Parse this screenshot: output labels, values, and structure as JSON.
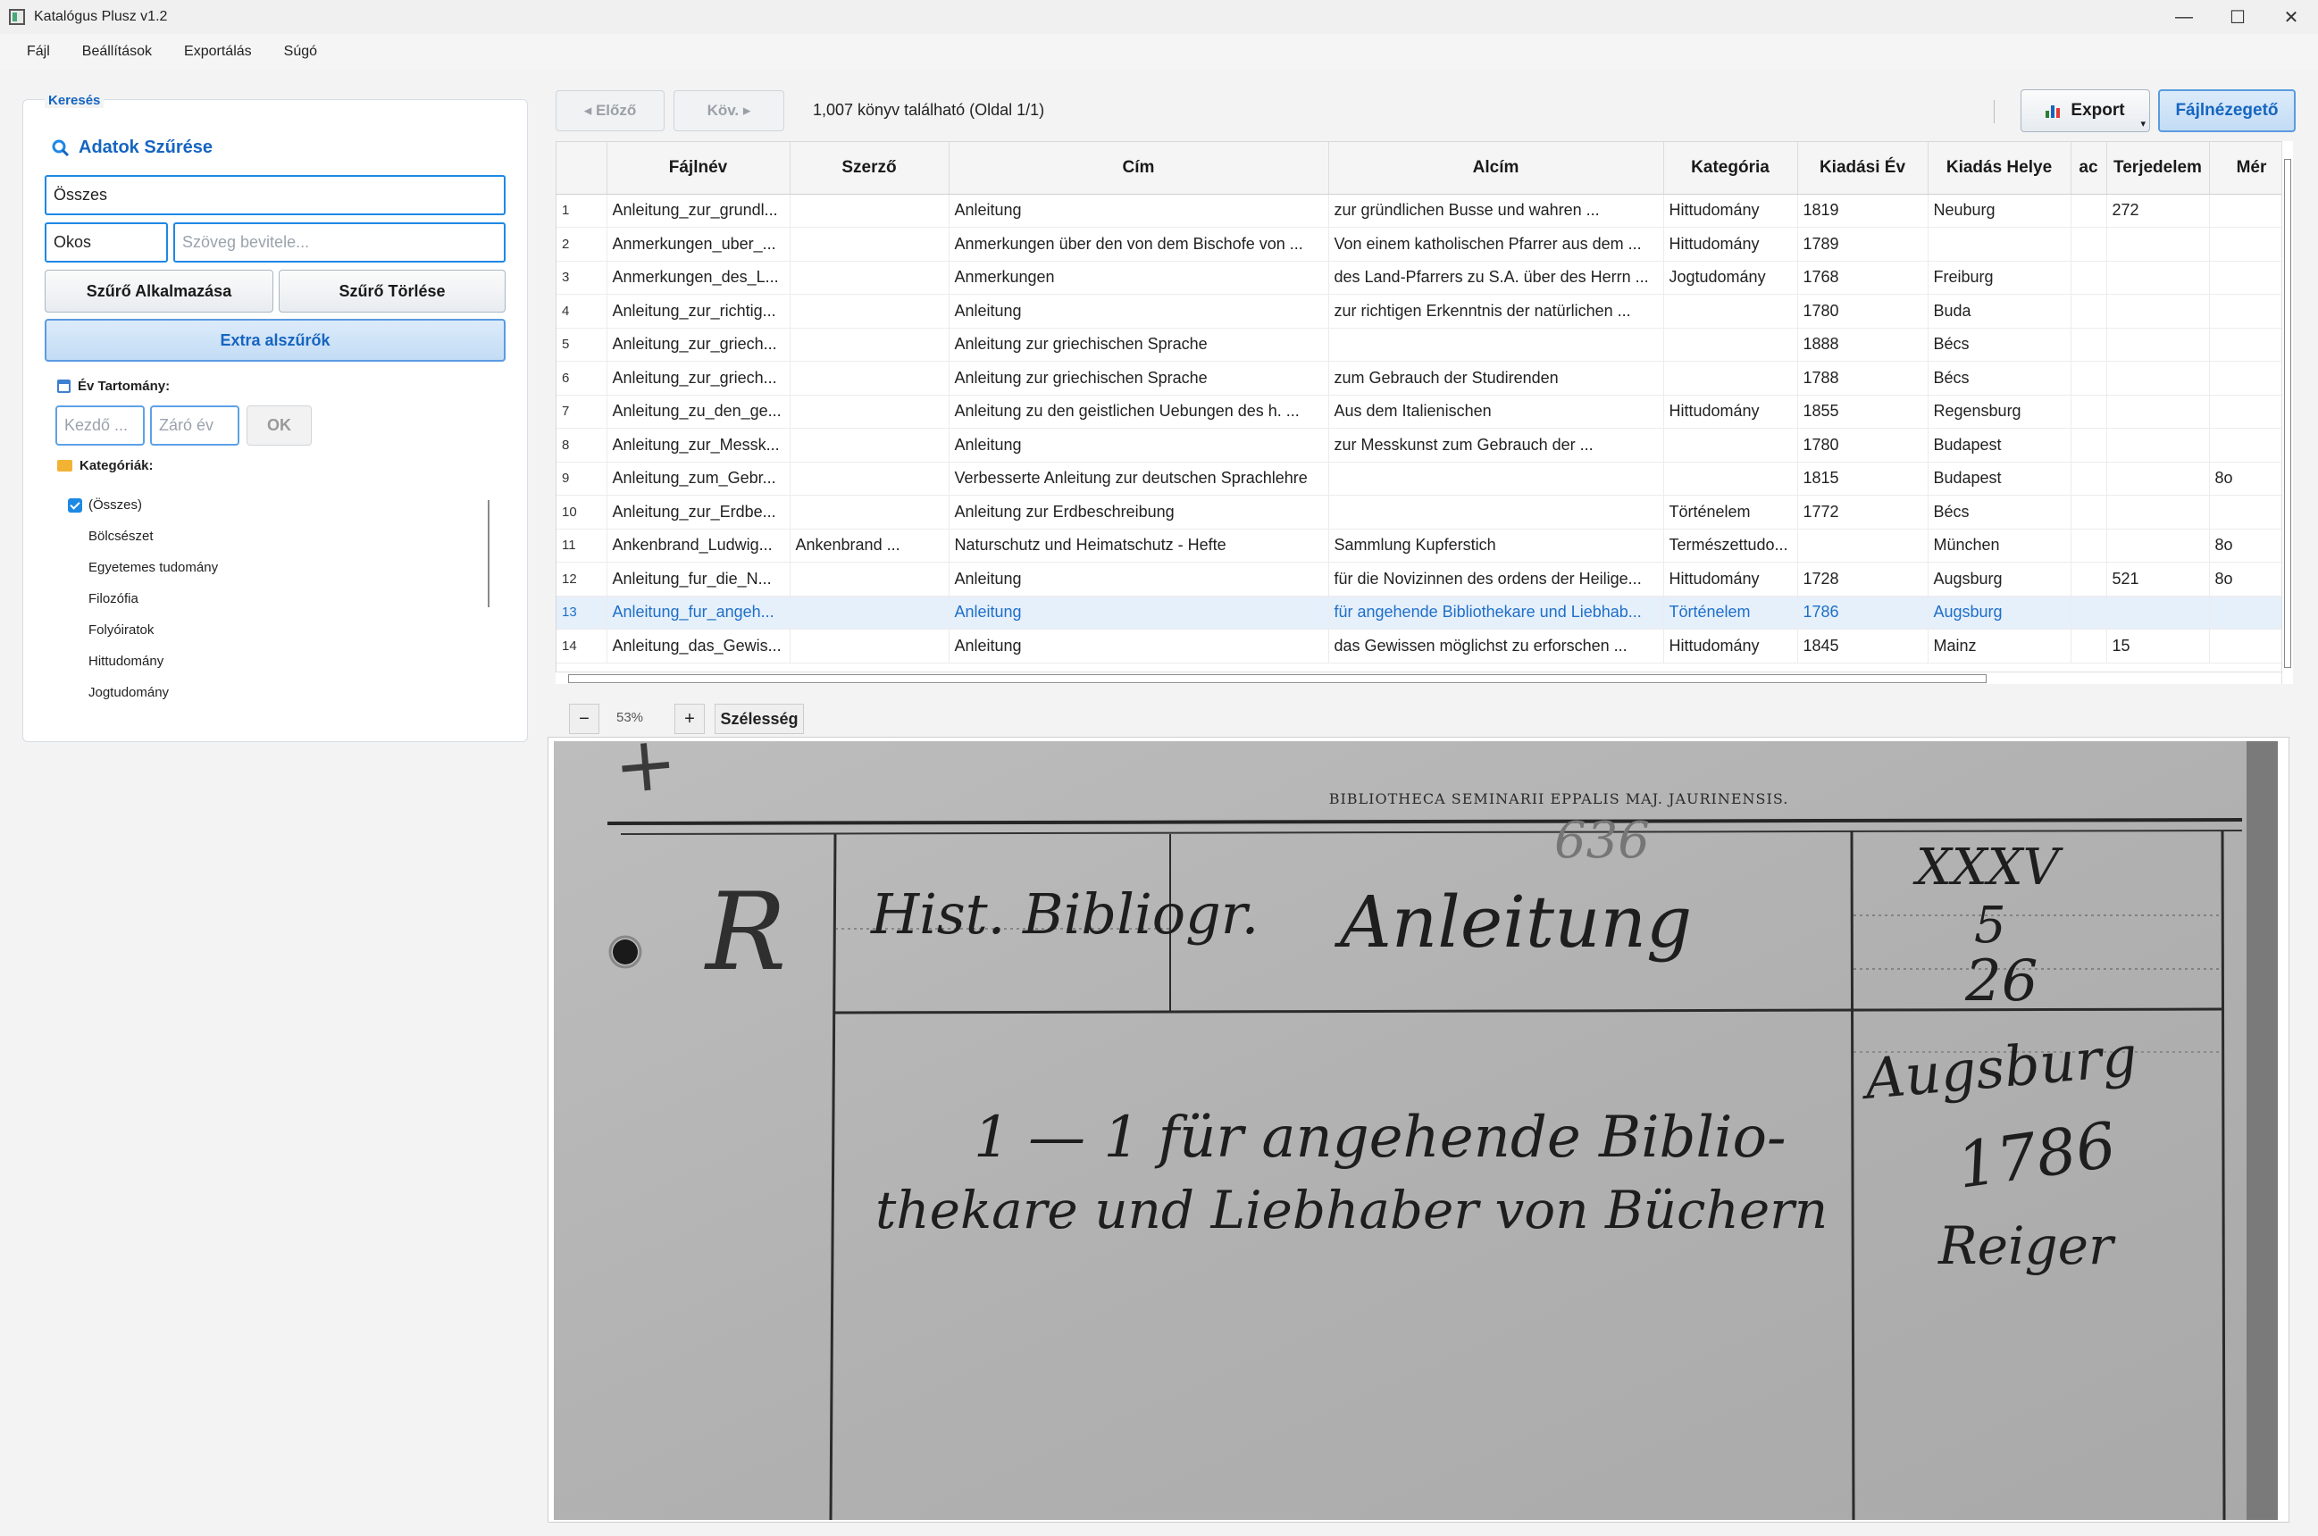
{
  "window": {
    "title": "Katalógus Plusz v1.2",
    "minimize": "—",
    "maximize": "☐",
    "close": "✕"
  },
  "menu": [
    "Fájl",
    "Beállítások",
    "Exportálás",
    "Súgó"
  ],
  "search_panel": {
    "group_title": "Keresés",
    "heading": "Adatok Szűrése",
    "field_select": "Összes",
    "mode_select": "Okos",
    "text_placeholder": "Szöveg bevitele...",
    "apply_button": "Szűrő Alkalmazása",
    "clear_button": "Szűrő Törlése",
    "extra_button": "Extra alszűrők",
    "year_label": "Év Tartomány:",
    "year_start_placeholder": "Kezdő ...",
    "year_end_placeholder": "Záró év",
    "ok_button": "OK",
    "categories_label": "Kategóriák:",
    "categories": [
      "(Összes)",
      "Bölcsészet",
      "Egyetemes tudomány",
      "Filozófia",
      "Folyóiratok",
      "Hittudomány",
      "Jogtudomány"
    ]
  },
  "toolbar": {
    "prev_button": "◂ Előző",
    "next_button": "Köv. ▸",
    "result_text": "1,007 könyv található (Oldal 1/1)",
    "export_button": "Export",
    "viewer_button": "Fájlnézegető"
  },
  "table": {
    "columns": [
      "",
      "Fájlnév",
      "Szerző",
      "Cím",
      "Alcím",
      "Kategória",
      "Kiadási Év",
      "Kiadás Helye",
      "ac",
      "Terjedelem",
      "Mér"
    ],
    "rows": [
      [
        "1",
        "Anleitung_zur_grundl...",
        "",
        "Anleitung",
        "zur gründlichen Busse und wahren ...",
        "Hittudomány",
        "1819",
        "Neuburg",
        "",
        "272",
        ""
      ],
      [
        "2",
        "Anmerkungen_uber_...",
        "",
        "Anmerkungen über den von dem Bischofe von ...",
        "Von einem katholischen Pfarrer aus dem ...",
        "Hittudomány",
        "1789",
        "",
        "",
        "",
        ""
      ],
      [
        "3",
        "Anmerkungen_des_L...",
        "",
        "Anmerkungen",
        "des Land-Pfarrers zu S.A. über des Herrn ...",
        "Jogtudomány",
        "1768",
        "Freiburg",
        "",
        "",
        ""
      ],
      [
        "4",
        "Anleitung_zur_richtig...",
        "",
        "Anleitung",
        "zur richtigen Erkenntnis der natürlichen ...",
        "",
        "1780",
        "Buda",
        "",
        "",
        ""
      ],
      [
        "5",
        "Anleitung_zur_griech...",
        "",
        "Anleitung zur griechischen Sprache",
        "",
        "",
        "1888",
        "Bécs",
        "",
        "",
        ""
      ],
      [
        "6",
        "Anleitung_zur_griech...",
        "",
        "Anleitung zur griechischen Sprache",
        "zum Gebrauch der Studirenden",
        "",
        "1788",
        "Bécs",
        "",
        "",
        ""
      ],
      [
        "7",
        "Anleitung_zu_den_ge...",
        "",
        "Anleitung zu den geistlichen Uebungen des h. ...",
        "Aus dem Italienischen",
        "Hittudomány",
        "1855",
        "Regensburg",
        "",
        "",
        ""
      ],
      [
        "8",
        "Anleitung_zur_Messk...",
        "",
        "Anleitung",
        "zur Messkunst zum Gebrauch der ...",
        "",
        "1780",
        "Budapest",
        "",
        "",
        ""
      ],
      [
        "9",
        "Anleitung_zum_Gebr...",
        "",
        "Verbesserte Anleitung zur deutschen Sprachlehre",
        "",
        "",
        "1815",
        "Budapest",
        "",
        "",
        "8o"
      ],
      [
        "10",
        "Anleitung_zur_Erdbe...",
        "",
        "Anleitung zur Erdbeschreibung",
        "",
        "Történelem",
        "1772",
        "Bécs",
        "",
        "",
        ""
      ],
      [
        "11",
        "Ankenbrand_Ludwig...",
        "Ankenbrand ...",
        "Naturschutz und Heimatschutz - Hefte",
        "Sammlung Kupferstich",
        "Természettudo...",
        "",
        "München",
        "",
        "",
        "8o"
      ],
      [
        "12",
        "Anleitung_fur_die_N...",
        "",
        "Anleitung",
        "für die Novizinnen des ordens der Heilige...",
        "Hittudomány",
        "1728",
        "Augsburg",
        "",
        "521",
        "8o"
      ],
      [
        "13",
        "Anleitung_fur_angeh...",
        "",
        "Anleitung",
        "für angehende Bibliothekare und Liebhab...",
        "Történelem",
        "1786",
        "Augsburg",
        "",
        "",
        ""
      ],
      [
        "14",
        "Anleitung_das_Gewis...",
        "",
        "Anleitung",
        "das Gewissen möglichst zu erforschen ...",
        "Hittudomány",
        "1845",
        "Mainz",
        "",
        "15",
        ""
      ]
    ],
    "selected_row": 13
  },
  "zoom": {
    "minus": "−",
    "level": "53%",
    "plus": "+",
    "width_button": "Szélesség"
  },
  "card": {
    "header": "BIBLIOTHECA SEMINARII EPPALIS MAJ. JAURINENSIS.",
    "cross": "+",
    "letter": "R",
    "number": "636",
    "subject": "Hist. Bibliogr.",
    "title_hand": "Anleitung",
    "shelf": [
      "XXXV",
      "5",
      "26"
    ],
    "line1": "1 — 1  für angehende Biblio-",
    "line2": "thekare und Liebhaber von Büchern",
    "place": "Augsburg",
    "year": "1786",
    "publisher": "Reiger"
  }
}
